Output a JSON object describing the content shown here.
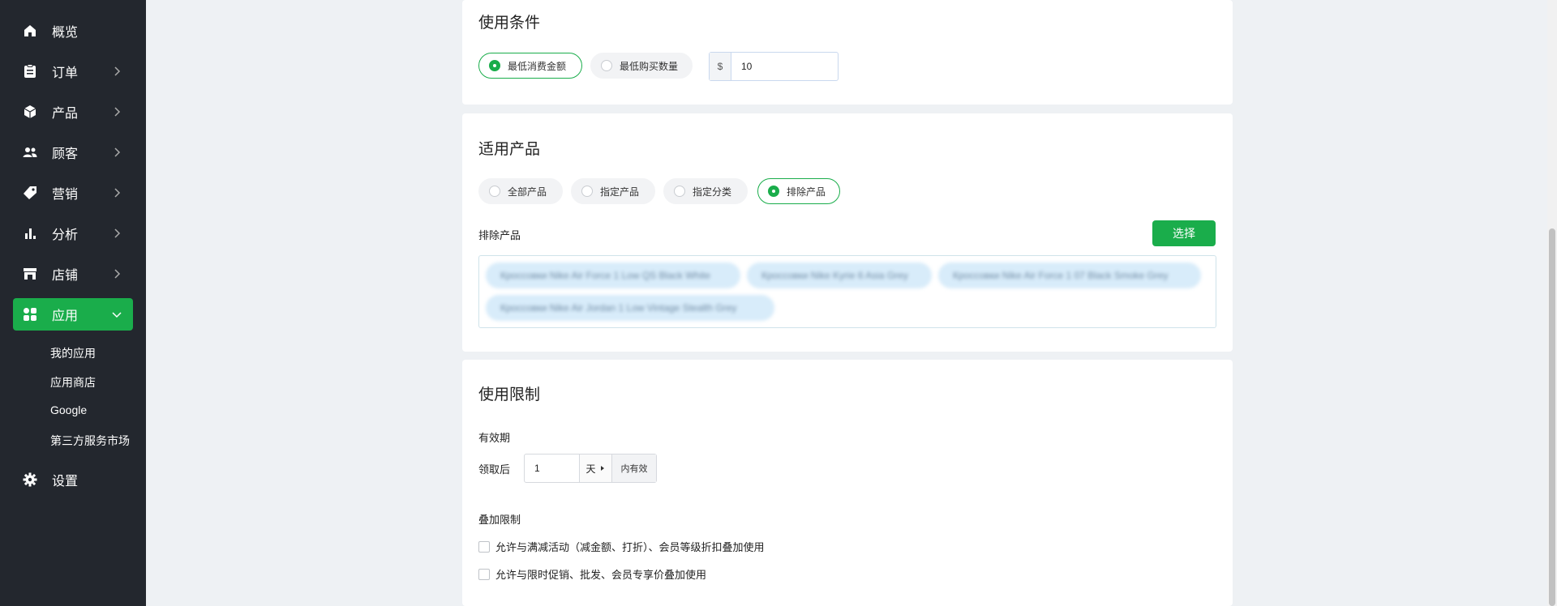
{
  "sidebar": {
    "items": [
      {
        "label": "概览",
        "icon": "home-icon"
      },
      {
        "label": "订单",
        "icon": "clipboard-icon"
      },
      {
        "label": "产品",
        "icon": "box-icon"
      },
      {
        "label": "顾客",
        "icon": "users-icon"
      },
      {
        "label": "营销",
        "icon": "tag-icon"
      },
      {
        "label": "分析",
        "icon": "bar-chart-icon"
      },
      {
        "label": "店铺",
        "icon": "store-icon"
      },
      {
        "label": "应用",
        "icon": "apps-icon"
      },
      {
        "label": "设置",
        "icon": "gear-icon"
      }
    ],
    "subitems": [
      "我的应用",
      "应用商店",
      "Google",
      "第三方服务市场"
    ]
  },
  "conditions": {
    "title": "使用条件",
    "options": [
      "最低消费金额",
      "最低购买数量"
    ],
    "selected": "最低消费金额",
    "currency": "$",
    "amount": "10"
  },
  "products": {
    "title": "适用产品",
    "options": [
      "全部产品",
      "指定产品",
      "指定分类",
      "排除产品"
    ],
    "selected": "排除产品",
    "excluded_label": "排除产品",
    "select_button": "选择",
    "tags": [
      "Кроссовки Nike Air Force 1 Low QS Black White",
      "Кроссовки Nike Kyrie 6 Asia Grey",
      "Кроссовки Nike Air Force 1 07 Black Smoke Grey",
      "Кроссовки Nike Air Jordan 1 Low Vintage Stealth Grey"
    ]
  },
  "limits": {
    "title": "使用限制",
    "validity_label": "有效期",
    "after_receive": "领取后",
    "days_value": "1",
    "unit": "天",
    "suffix": "内有效",
    "stack_label": "叠加限制",
    "stack_options": [
      "允许与满减活动（减金额、打折）、会员等级折扣叠加使用",
      "允许与限时促销、批发、会员专享价叠加使用"
    ]
  },
  "colors": {
    "accent": "#1aad4b",
    "sidebar": "#23272e",
    "background": "#eef1f4"
  }
}
